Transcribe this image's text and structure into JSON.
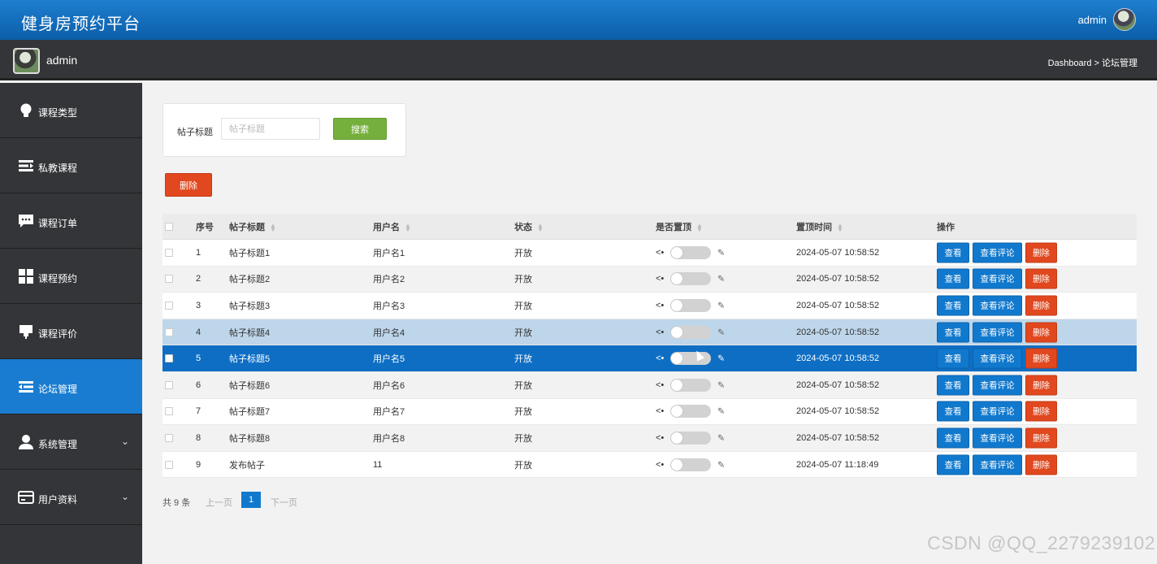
{
  "header": {
    "title": "健身房预约平台",
    "user": "admin"
  },
  "subbar": {
    "name": "admin",
    "breadcrumb": "Dashboard > 论坛管理"
  },
  "sidebar": {
    "items": [
      {
        "label": "课程类型",
        "icon": "lightbulb-icon",
        "active": false
      },
      {
        "label": "私教课程",
        "icon": "list-indent-icon",
        "active": false
      },
      {
        "label": "课程订单",
        "icon": "chat-bubble-icon",
        "active": false
      },
      {
        "label": "课程预约",
        "icon": "grid-icon",
        "active": false
      },
      {
        "label": "课程评价",
        "icon": "stamp-icon",
        "active": false
      },
      {
        "label": "论坛管理",
        "icon": "list-outdent-icon",
        "active": true
      },
      {
        "label": "系统管理",
        "icon": "user-icon",
        "active": false,
        "expandable": true
      },
      {
        "label": "用户资料",
        "icon": "card-icon",
        "active": false,
        "expandable": true
      }
    ]
  },
  "search": {
    "label": "帖子标题",
    "placeholder": "帖子标题",
    "button": "搜索"
  },
  "toolbar": {
    "delete_label": "删除"
  },
  "table": {
    "columns": [
      "序号",
      "帖子标题",
      "用户名",
      "状态",
      "是否置顶",
      "置顶时间",
      "操作"
    ],
    "rows": [
      {
        "no": "1",
        "title": "帖子标题1",
        "user": "用户名1",
        "status": "开放",
        "time": "2024-05-07 10:58:52"
      },
      {
        "no": "2",
        "title": "帖子标题2",
        "user": "用户名2",
        "status": "开放",
        "time": "2024-05-07 10:58:52"
      },
      {
        "no": "3",
        "title": "帖子标题3",
        "user": "用户名3",
        "status": "开放",
        "time": "2024-05-07 10:58:52"
      },
      {
        "no": "4",
        "title": "帖子标题4",
        "user": "用户名4",
        "status": "开放",
        "time": "2024-05-07 10:58:52",
        "hover": true
      },
      {
        "no": "5",
        "title": "帖子标题5",
        "user": "用户名5",
        "status": "开放",
        "time": "2024-05-07 10:58:52",
        "selected": true
      },
      {
        "no": "6",
        "title": "帖子标题6",
        "user": "用户名6",
        "status": "开放",
        "time": "2024-05-07 10:58:52"
      },
      {
        "no": "7",
        "title": "帖子标题7",
        "user": "用户名7",
        "status": "开放",
        "time": "2024-05-07 10:58:52"
      },
      {
        "no": "8",
        "title": "帖子标题8",
        "user": "用户名8",
        "status": "开放",
        "time": "2024-05-07 10:58:52"
      },
      {
        "no": "9",
        "title": "发布帖子",
        "user": "11",
        "status": "开放",
        "time": "2024-05-07 11:18:49"
      }
    ],
    "actions": {
      "view": "查看",
      "comments": "查看评论",
      "delete": "删除"
    }
  },
  "pager": {
    "total": "共 9 条",
    "prev": "上一页",
    "page": "1",
    "next": "下一页"
  },
  "watermark": "CSDN @QQ_2279239102",
  "colors": {
    "primary": "#1179cd",
    "danger": "#e1481f",
    "success": "#76b03c",
    "sidebar": "#333538"
  }
}
